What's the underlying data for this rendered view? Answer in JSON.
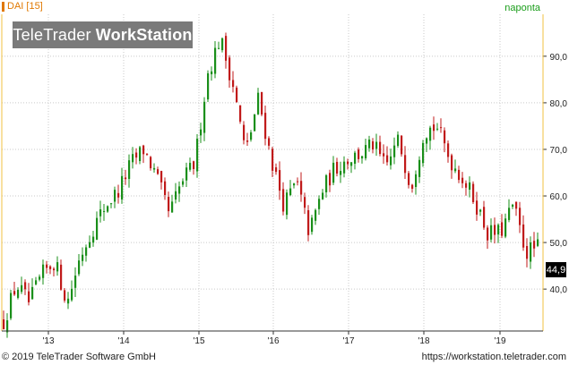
{
  "header": {
    "symbol": "DAI [15]",
    "source": "naponta"
  },
  "logo": {
    "part1": "TeleTrader",
    "part2": "WorkStation"
  },
  "footer": {
    "copyright": "© 2019 TeleTrader Software GmbH",
    "url": "https://workstation.teletrader.com"
  },
  "last_price_label": "44,9",
  "colors": {
    "up": "#1a8f1a",
    "down": "#c01a1a",
    "grid": "#c9c9c9",
    "axis_line": "#f0c040",
    "header_orange": "#e07800",
    "header_green": "#1a9d1a"
  },
  "chart_data": {
    "type": "candlestick",
    "title": "DAI [15]",
    "xlabel": "",
    "ylabel": "",
    "ylim": [
      31,
      99
    ],
    "y_ticks": [
      40,
      50,
      60,
      70,
      80,
      90
    ],
    "y_tick_labels": [
      "40,0",
      "50,0",
      "60,0",
      "70,0",
      "80,0",
      "90,0"
    ],
    "x_ticks": [
      "'13",
      "'14",
      "'15",
      "'16",
      "'17",
      "'18",
      "'19"
    ],
    "last_value": 44.9,
    "grid": true,
    "x": [
      "2012-07",
      "2012-09",
      "2012-11",
      "2013-01",
      "2013-03",
      "2013-05",
      "2013-07",
      "2013-09",
      "2013-11",
      "2014-01",
      "2014-03",
      "2014-05",
      "2014-07",
      "2014-09",
      "2014-11",
      "2015-01",
      "2015-03",
      "2015-05",
      "2015-07",
      "2015-09",
      "2015-11",
      "2016-01",
      "2016-03",
      "2016-05",
      "2016-07",
      "2016-09",
      "2016-11",
      "2017-01",
      "2017-03",
      "2017-05",
      "2017-07",
      "2017-09",
      "2017-11",
      "2018-01",
      "2018-03",
      "2018-05",
      "2018-07",
      "2018-09",
      "2018-11",
      "2019-01",
      "2019-03",
      "2019-05",
      "2019-07"
    ],
    "close": [
      33,
      41,
      37,
      43,
      46,
      37,
      47,
      53,
      58,
      61,
      67,
      70,
      64,
      56,
      63,
      67,
      86,
      94,
      84,
      69,
      81,
      68,
      58,
      63,
      52,
      61,
      66,
      68,
      69,
      71,
      66,
      72,
      62,
      74,
      75,
      68,
      64,
      59,
      52,
      52,
      58,
      48,
      49
    ]
  }
}
